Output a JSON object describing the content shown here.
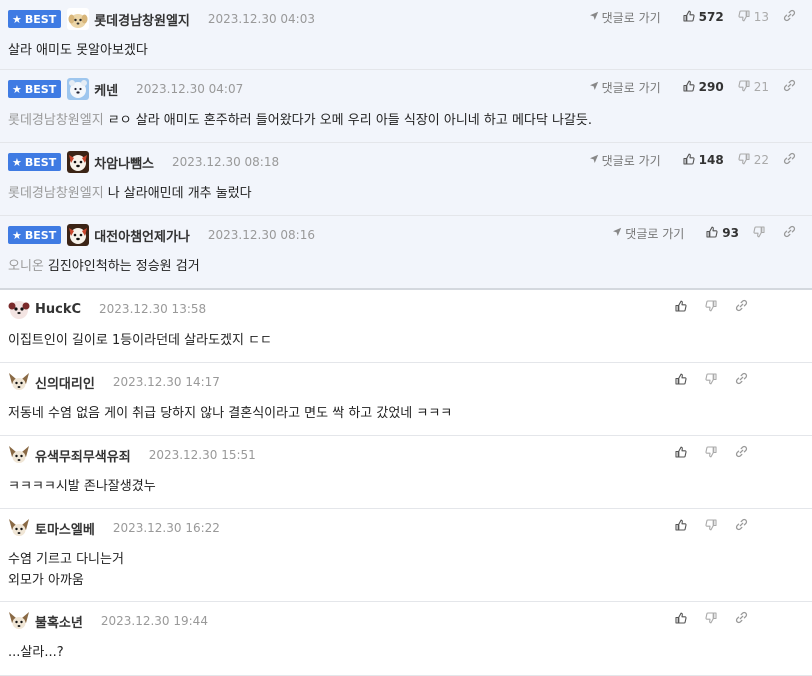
{
  "labels": {
    "best": "BEST",
    "goto": "댓글로 가기"
  },
  "colors": {
    "accent": "#3f7be3",
    "best_bg": "#f2f5fb"
  },
  "icons": {
    "badge": "star-icon",
    "goto": "arrow-icon",
    "up": "thumbs-up-icon",
    "down": "thumbs-down-icon",
    "link": "link-icon"
  },
  "comments": [
    {
      "best": true,
      "avatar": "puppy",
      "nick": "롯데경남창원엘지",
      "date": "2023.12.30 04:03",
      "mention": "",
      "text": "살라 애미도 못알아보겠다",
      "up": "572",
      "down": "13"
    },
    {
      "best": true,
      "avatar": "bear",
      "nick": "케넨",
      "date": "2023.12.30 04:07",
      "mention": "롯데경남창원엘지",
      "text": "ㄹㅇ 살라 애미도 혼주하러 들어왔다가 오메 우리 아들 식장이 아니네 하고 메다닥 나갈듯.",
      "up": "290",
      "down": "21"
    },
    {
      "best": true,
      "avatar": "dog",
      "nick": "차암나뺌스",
      "date": "2023.12.30 08:18",
      "mention": "롯데경남창원엘지",
      "text": "나 살라애민데 개추 눌렀다",
      "up": "148",
      "down": "22"
    },
    {
      "best": true,
      "avatar": "dog",
      "nick": "대전아챔언제가나",
      "date": "2023.12.30 08:16",
      "mention": "오니온",
      "text": "김진야인척하는 정승원 검거",
      "up": "93",
      "down": ""
    },
    {
      "best": false,
      "avatar": "fluffy",
      "nick": "HuckC",
      "date": "2023.12.30 13:58",
      "mention": "",
      "text": "이집트인이 길이로 1등이라던데 살라도겠지 ㄷㄷ",
      "up": "",
      "down": ""
    },
    {
      "best": false,
      "avatar": "chihuahua",
      "nick": "신의대리인",
      "date": "2023.12.30 14:17",
      "mention": "",
      "text": "저동네 수염 없음 게이 취급 당하지 않나 결혼식이라고 면도 싹 하고 갔었네 ㅋㅋㅋ",
      "up": "",
      "down": ""
    },
    {
      "best": false,
      "avatar": "chihuahua",
      "nick": "유색무죄무색유죄",
      "date": "2023.12.30 15:51",
      "mention": "",
      "text": "ㅋㅋㅋㅋ시발 존나잘생겼누",
      "up": "",
      "down": ""
    },
    {
      "best": false,
      "avatar": "chihuahua",
      "nick": "토마스엘베",
      "date": "2023.12.30 16:22",
      "mention": "",
      "text": "수염 기르고 다니는거\n외모가 아까움",
      "up": "",
      "down": ""
    },
    {
      "best": false,
      "avatar": "chihuahua",
      "nick": "불혹소년",
      "date": "2023.12.30 19:44",
      "mention": "",
      "text": "...살라...?",
      "up": "",
      "down": ""
    }
  ]
}
